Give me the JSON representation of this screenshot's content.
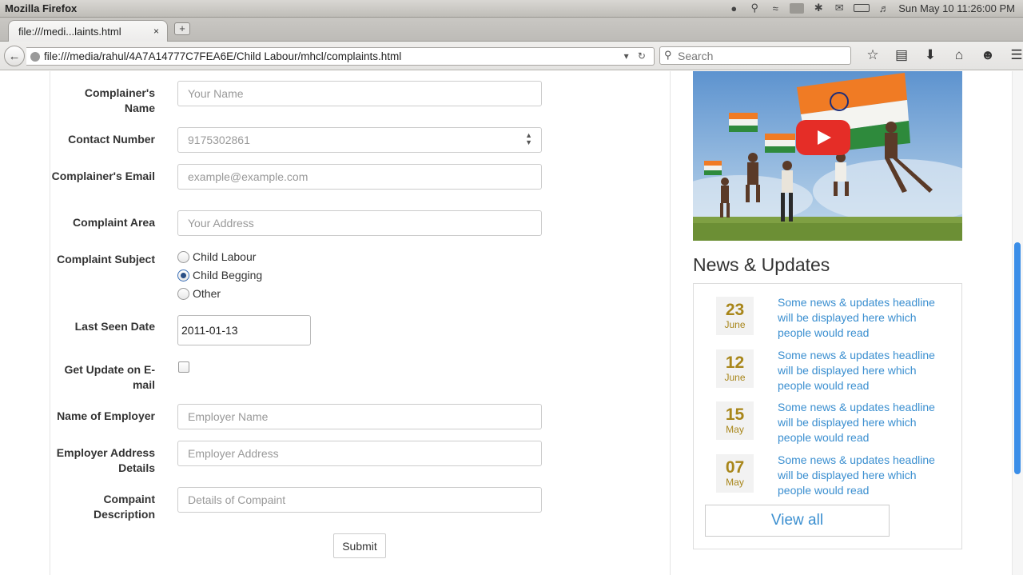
{
  "os": {
    "app_name": "Mozilla Firefox",
    "clock": "Sun May 10 11:26:00 PM",
    "tray_icons": [
      "apple-icon",
      "search-icon",
      "wifi-icon",
      "en-icon",
      "bluetooth-icon",
      "mail-icon",
      "battery-icon",
      "volume-icon"
    ]
  },
  "browser": {
    "tab_title": "file:///medi...laints.html",
    "tab_close": "×",
    "new_tab": "+",
    "url": "file:///media/rahul/4A7A14777C7FEA6E/Child Labour/mhcl/complaints.html",
    "url_icons": "▾ ↻",
    "search_placeholder": "Search",
    "toolbar_icons": [
      "star-icon",
      "reading-list-icon",
      "download-icon",
      "home-icon",
      "chat-icon",
      "menu-icon"
    ]
  },
  "form": {
    "name_label": "Complainer's Name",
    "name_placeholder": "Your Name",
    "contact_label": "Contact Number",
    "contact_placeholder": "9175302861",
    "email_label": "Complainer's Email",
    "email_placeholder": "example@example.com",
    "area_label": "Complaint Area",
    "area_placeholder": "Your Address",
    "subject_label": "Complaint Subject",
    "subject_options": [
      {
        "label": "Child Labour",
        "selected": false
      },
      {
        "label": "Child Begging",
        "selected": true
      },
      {
        "label": "Other",
        "selected": false
      }
    ],
    "date_label": "Last Seen Date",
    "date_value": "2011-01-13",
    "update_label": "Get Update on E-mail",
    "update_checked": false,
    "employer_label": "Name of Employer",
    "employer_placeholder": "Employer Name",
    "employer_addr_label": "Employer Address Details",
    "employer_addr_placeholder": "Employer Address",
    "description_label": "Compaint Description",
    "description_placeholder": "Details of Compaint",
    "submit_label": "Submit"
  },
  "sidebar": {
    "video_icon": "youtube-play-icon",
    "news_title": "News & Updates",
    "news": [
      {
        "day": "23",
        "month": "June",
        "headline": "Some news & updates headline will be displayed here which people would read"
      },
      {
        "day": "12",
        "month": "June",
        "headline": "Some news & updates headline will be displayed here which people would read"
      },
      {
        "day": "15",
        "month": "May",
        "headline": "Some news & updates headline will be displayed here which people would read"
      },
      {
        "day": "07",
        "month": "May",
        "headline": "Some news & updates headline will be displayed here which people would read"
      }
    ],
    "view_all": "View all"
  },
  "colors": {
    "accent_link": "#3b8fd0",
    "date_gold": "#a8861a",
    "play_red": "#e52d27"
  }
}
